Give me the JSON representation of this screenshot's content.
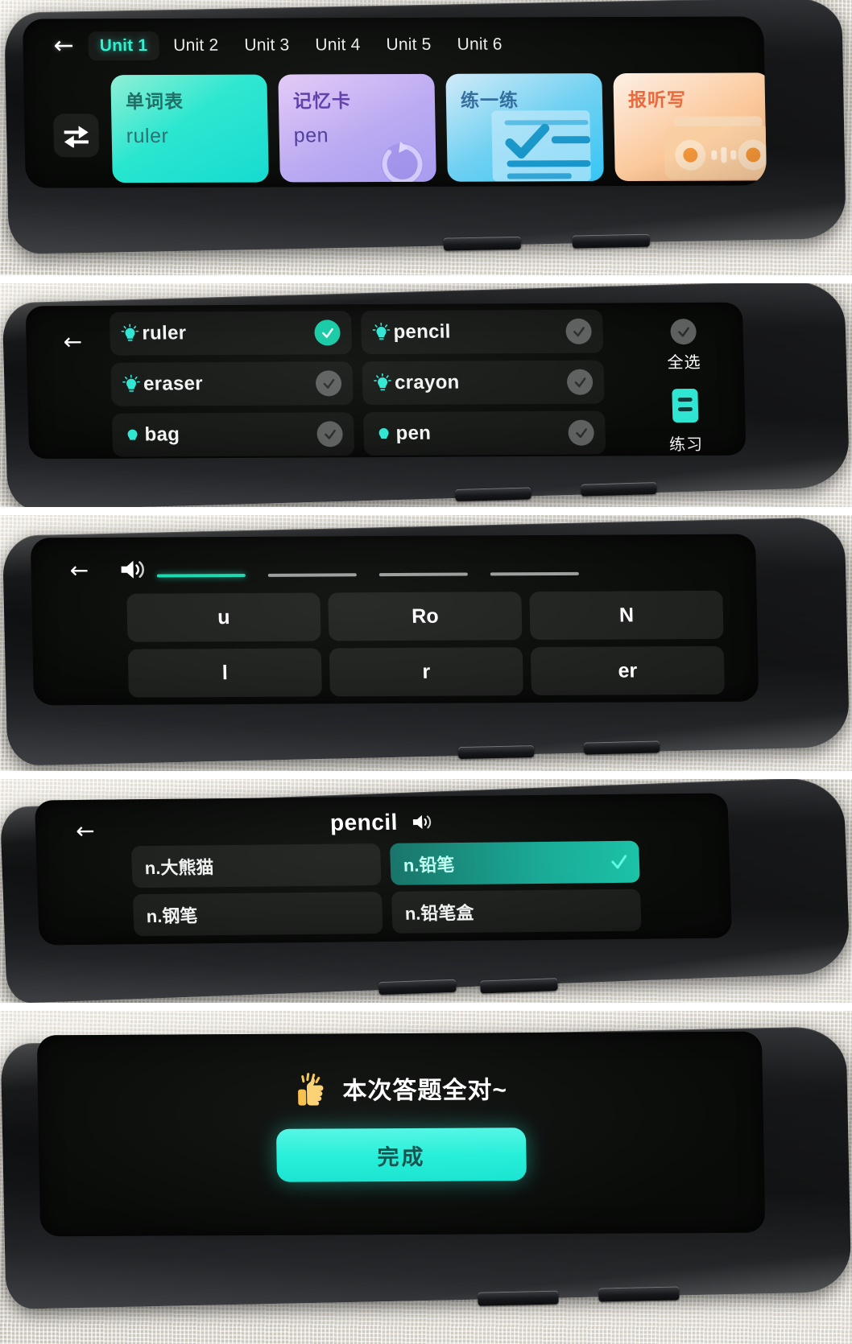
{
  "device": {
    "name": "dictionary-pen"
  },
  "panel1": {
    "back_icon": "back-arrow-icon",
    "swap_icon": "swap-arrows-icon",
    "tabs": [
      {
        "label": "Unit 1",
        "active": true
      },
      {
        "label": "Unit 2",
        "active": false
      },
      {
        "label": "Unit 3",
        "active": false
      },
      {
        "label": "Unit 4",
        "active": false
      },
      {
        "label": "Unit 5",
        "active": false
      },
      {
        "label": "Unit 6",
        "active": false
      }
    ],
    "cards": [
      {
        "title": "单词表",
        "sub": "ruler",
        "accent": "#15dbd0",
        "art": "none"
      },
      {
        "title": "记忆卡",
        "sub": "pen",
        "accent": "#a79bef",
        "art": "card-flip-icon"
      },
      {
        "title": "练一练",
        "sub": "",
        "accent": "#35c6f4",
        "art": "checklist-icon"
      },
      {
        "title": "报听写",
        "sub": "",
        "accent": "#f7b27e",
        "art": "radio-cassette-icon"
      }
    ]
  },
  "panel2": {
    "back_icon": "back-arrow-icon",
    "words": [
      {
        "text": "ruler",
        "checked": true
      },
      {
        "text": "pencil",
        "checked": false
      },
      {
        "text": "eraser",
        "checked": false
      },
      {
        "text": "crayon",
        "checked": false
      },
      {
        "text": "bag",
        "checked": false
      },
      {
        "text": "pen",
        "checked": false
      }
    ],
    "select_all_label": "全选",
    "practice_label": "练习",
    "bulb_icon": "lightbulb-icon",
    "check_icon": "check-icon",
    "doc_icon": "document-icon"
  },
  "panel3": {
    "back_icon": "back-arrow-icon",
    "speaker_icon": "speaker-icon",
    "blanks": [
      {
        "filled": true
      },
      {
        "filled": false
      },
      {
        "filled": false
      },
      {
        "filled": false
      }
    ],
    "tiles": [
      [
        "u",
        "Ro",
        "N"
      ],
      [
        "l",
        "r",
        "er"
      ]
    ]
  },
  "panel4": {
    "back_icon": "back-arrow-icon",
    "word": "pencil",
    "speaker_icon": "speaker-icon",
    "options": [
      {
        "text": "n.大熊猫",
        "selected": false
      },
      {
        "text": "n.铅笔",
        "selected": true
      },
      {
        "text": "n.钢笔",
        "selected": false
      },
      {
        "text": "n.铅笔盒",
        "selected": false
      }
    ],
    "tick_icon": "check-icon"
  },
  "panel5": {
    "thumb_icon": "thumbs-up-icon",
    "message": "本次答题全对~",
    "done_label": "完成",
    "accent": "#22efd8"
  }
}
